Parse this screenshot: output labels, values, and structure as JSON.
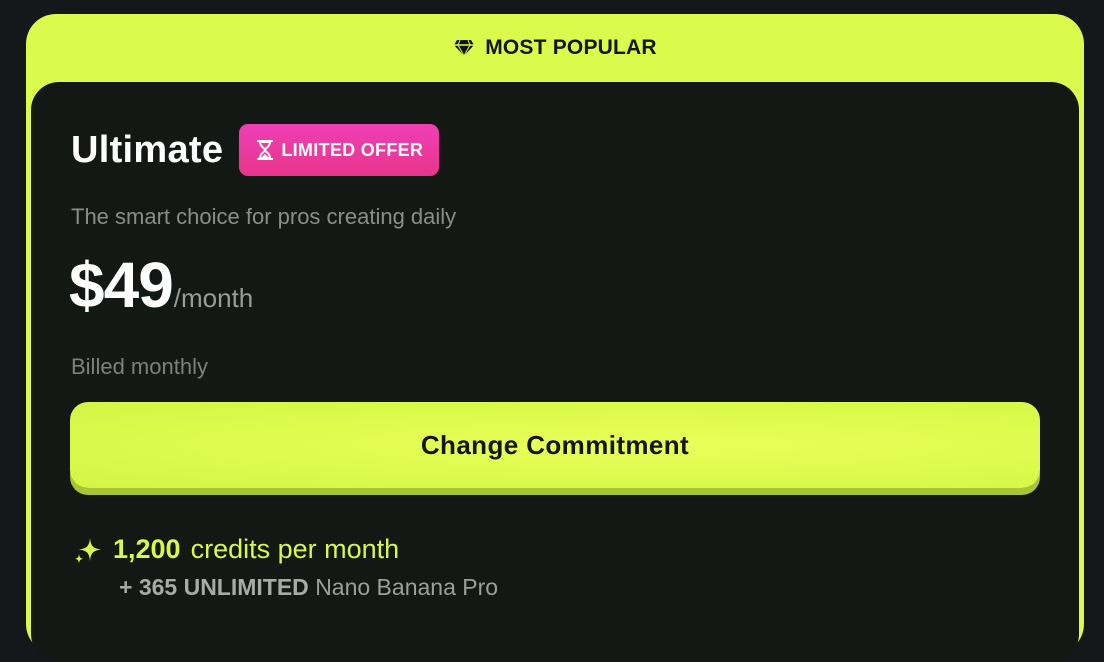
{
  "banner": {
    "icon": "diamond-icon",
    "label": "MOST POPULAR"
  },
  "plan": {
    "title": "Ultimate",
    "badge": {
      "icon": "hourglass-icon",
      "label": "LIMITED OFFER"
    },
    "subtitle": "The smart choice for pros creating daily",
    "price": "$49",
    "period": "/month",
    "billing": "Billed monthly",
    "cta_label": "Change Commitment"
  },
  "features": {
    "icon": "sparkle-icon",
    "credits_amount": "1,200",
    "credits_label": "credits per month",
    "extra_prefix": "+ 365 UNLIMITED",
    "extra_suffix": "Nano Banana Pro"
  },
  "colors": {
    "accent": "#dcfa4c",
    "card_bg": "#141814",
    "badge_pink": "#e8358c",
    "page_bg": "#15171a"
  }
}
